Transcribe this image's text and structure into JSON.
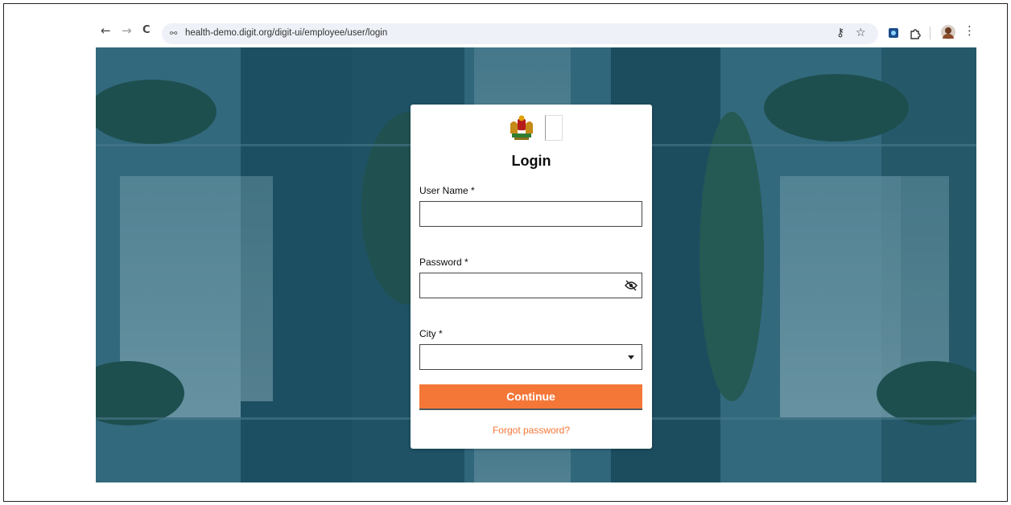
{
  "browser": {
    "back_icon": "←",
    "forward_icon": "→",
    "reload_icon": "C",
    "site_icon": "⚯",
    "url": "health-demo.digit.org/digit-ui/employee/user/login",
    "password_key_icon": "⚷",
    "bookmark_icon": "☆",
    "menu_icon": "⋮"
  },
  "login": {
    "title": "Login",
    "username_label": "User Name *",
    "username_value": "",
    "password_label": "Password *",
    "password_value": "",
    "city_label": "City *",
    "city_value": "",
    "continue_label": "Continue",
    "forgot_label": "Forgot password?"
  },
  "colors": {
    "accent": "#f47738",
    "background_tint": "#2b5f73",
    "card": "#ffffff",
    "text": "#0b0c0c"
  }
}
